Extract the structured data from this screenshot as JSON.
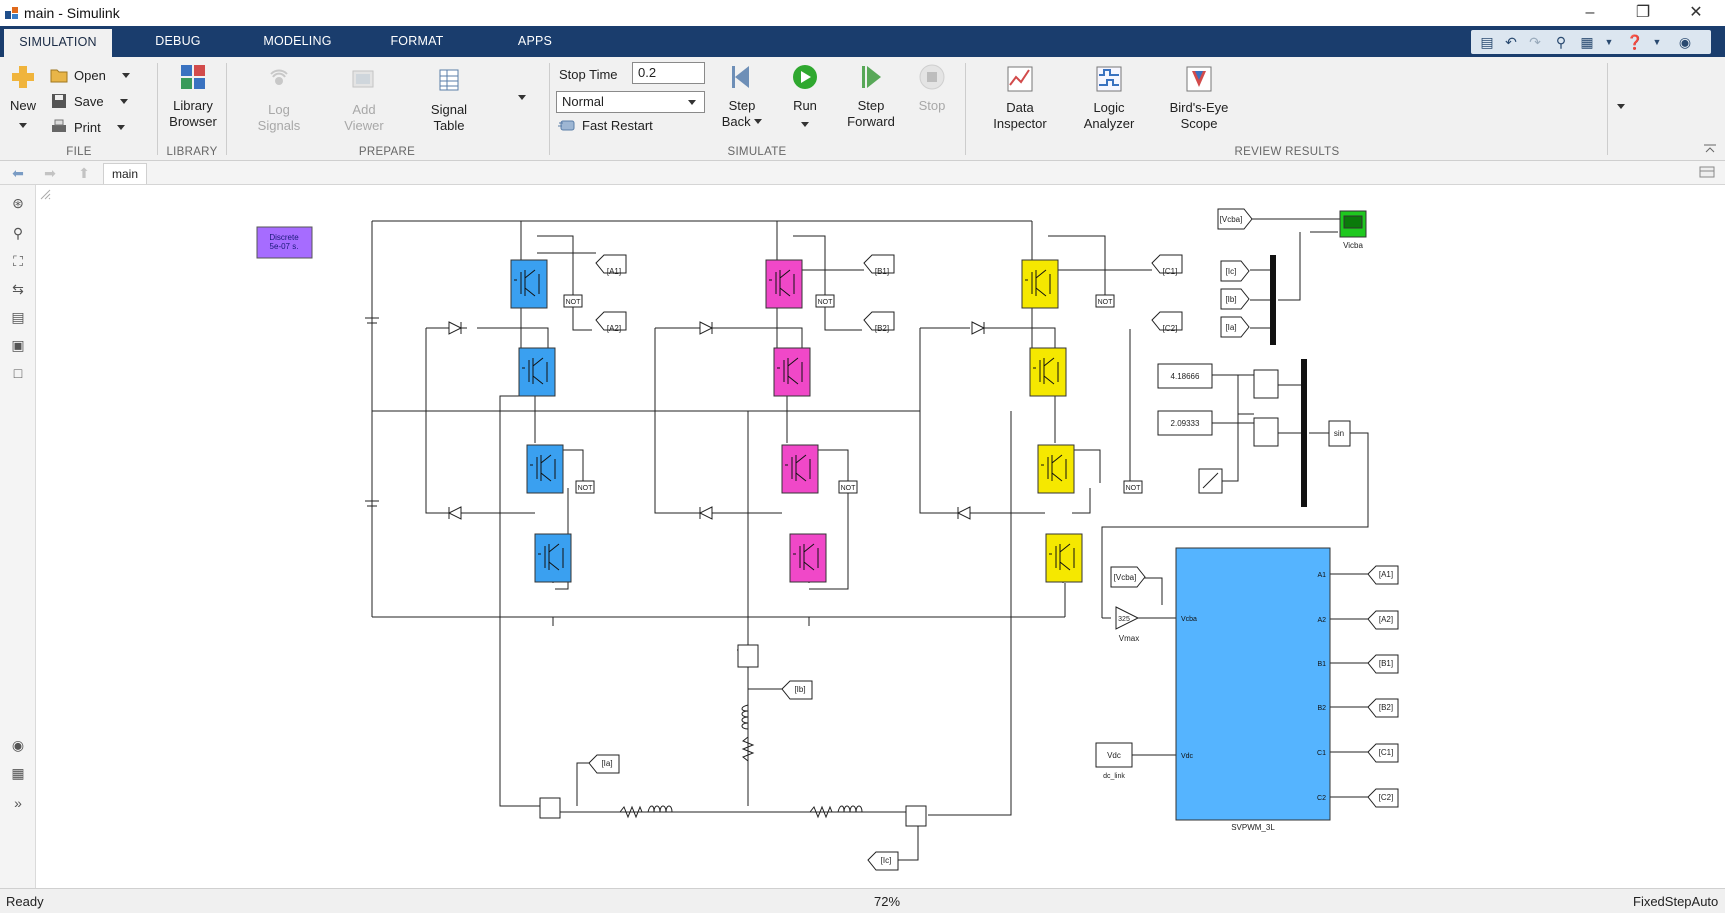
{
  "window": {
    "title": "main - Simulink"
  },
  "tabs": [
    {
      "label": "SIMULATION",
      "active": true
    },
    {
      "label": "DEBUG"
    },
    {
      "label": "MODELING"
    },
    {
      "label": "FORMAT"
    },
    {
      "label": "APPS"
    }
  ],
  "ribbon": {
    "file": {
      "section": "FILE",
      "new": "New",
      "open": "Open",
      "save": "Save",
      "print": "Print"
    },
    "library": {
      "section": "LIBRARY",
      "browser_line1": "Library",
      "browser_line2": "Browser"
    },
    "prepare": {
      "section": "PREPARE",
      "log_line1": "Log",
      "log_line2": "Signals",
      "add_line1": "Add",
      "add_line2": "Viewer",
      "signal_line1": "Signal",
      "signal_line2": "Table"
    },
    "simulate": {
      "section": "SIMULATE",
      "stop_time_label": "Stop Time",
      "stop_time_value": "0.2",
      "mode": "Normal",
      "fast_restart": "Fast Restart",
      "step_back_line1": "Step",
      "step_back_line2": "Back",
      "run": "Run",
      "step_forward_line1": "Step",
      "step_forward_line2": "Forward",
      "stop": "Stop"
    },
    "review": {
      "section": "REVIEW RESULTS",
      "data_line1": "Data",
      "data_line2": "Inspector",
      "logic_line1": "Logic",
      "logic_line2": "Analyzer",
      "birds_line1": "Bird's-Eye",
      "birds_line2": "Scope"
    }
  },
  "breadcrumb": {
    "model": "main"
  },
  "diagram": {
    "powergui_line1": "Discrete",
    "powergui_line2": "5e-07 s.",
    "goto_tags": [
      "[A1]",
      "[A2]",
      "[B1]",
      "[B2]",
      "[C1]",
      "[C2]"
    ],
    "not_label": "NOT",
    "measure_tags": {
      "ia": "[Ia]",
      "ib": "[Ib]",
      "ic": "[Ic]",
      "vcba": "[Vcba]"
    },
    "scope_label": "Vicba",
    "const1": "4.18666",
    "const2": "2.09333",
    "sin_label": "sin",
    "gain_value": "325",
    "gain_name": "Vmax",
    "vdc_const": "Vdc",
    "vdc_name": "dc_link",
    "svpwm_name": "SVPWM_3L",
    "svpwm_inputs": [
      "Vcba",
      "Vdc"
    ],
    "svpwm_outputs": [
      "A1",
      "A2",
      "B1",
      "B2",
      "C1",
      "C2"
    ],
    "colors": {
      "phase_a": "#3aa0f0",
      "phase_b": "#f048c8",
      "phase_c": "#f5e800",
      "svpwm": "#55b4ff",
      "powergui": "#a66cff",
      "scope": "#1ec81e"
    }
  },
  "status": {
    "left": "Ready",
    "zoom": "72%",
    "solver": "FixedStepAuto"
  }
}
